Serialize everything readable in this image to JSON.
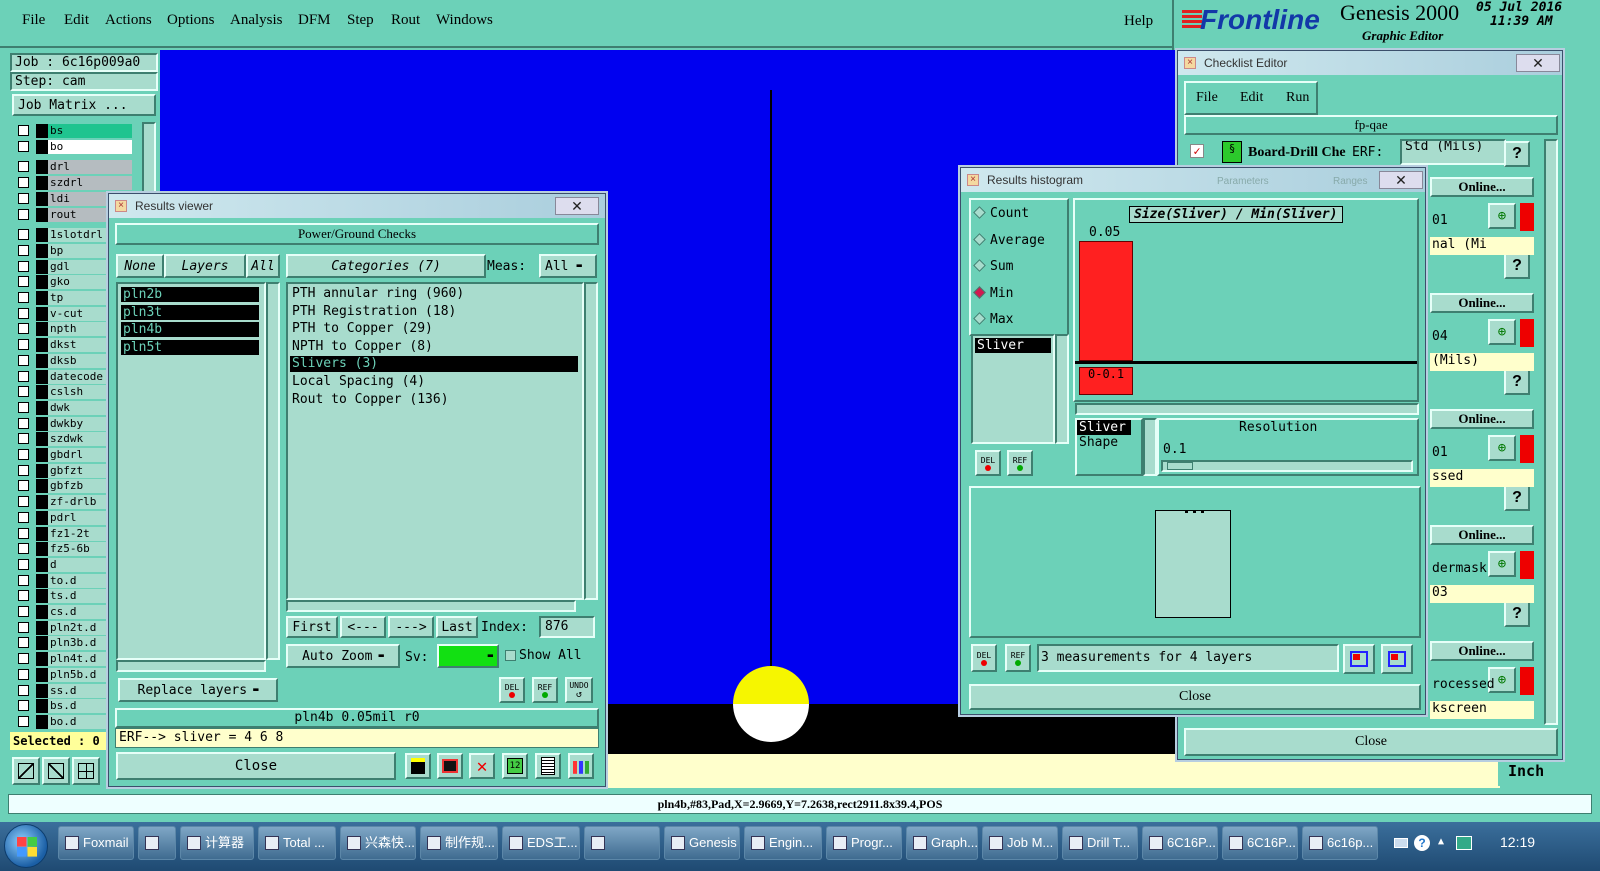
{
  "menu": [
    "File",
    "Edit",
    "Actions",
    "Options",
    "Analysis",
    "DFM",
    "Step",
    "Rout",
    "Windows"
  ],
  "help": "Help",
  "brand": {
    "logo": "Frontline",
    "product": "Genesis 2000",
    "subtitle": "Graphic Editor",
    "date": "05 Jul 2016",
    "time": "11:39 AM"
  },
  "job": {
    "job": "Job : 6c16p009a0",
    "step": "Step: cam",
    "matrix": "Job Matrix ...",
    "selected": "Selected : 0"
  },
  "layers": [
    "bs",
    "bo",
    "drl",
    "szdrl",
    "ldi",
    "rout",
    "1slotdrl",
    "bp",
    "gdl",
    "gko",
    "tp",
    "v-cut",
    "npth",
    "dkst",
    "dksb",
    "datecode",
    "cslsh",
    "dwk",
    "dwkby",
    "szdwk",
    "gbdrl",
    "gbfzt",
    "gbfzb",
    "zf-drlb",
    "pdrl",
    "fz1-2t",
    "fz5-6b",
    "d",
    "to.d",
    "ts.d",
    "cs.d",
    "pln2t.d",
    "pln3b.d",
    "pln4t.d",
    "pln5b.d",
    "ss.d",
    "bs.d",
    "bo.d"
  ],
  "results_viewer": {
    "title": "Results viewer",
    "header": "Power/Ground Checks",
    "none_btn": "None",
    "layers_btn": "Layers",
    "all_btn": "All",
    "categories_btn": "Categories (7)",
    "meas_label": "Meas:",
    "meas_value": "All",
    "layer_list": [
      "pln2b",
      "pln3t",
      "pln4b",
      "pln5t"
    ],
    "categories": [
      "PTH annular ring (960)",
      "PTH Registration (18)",
      "PTH to Copper (29)",
      "NPTH to Copper (8)",
      "Slivers (3)",
      "Local Spacing (4)",
      "Rout to Copper (136)"
    ],
    "selected_category": "Slivers (3)",
    "nav": {
      "first": "First",
      "prev": "<---",
      "next": "--->",
      "last": "Last",
      "index_label": "Index:",
      "index_value": "876"
    },
    "auto_zoom": "Auto Zoom",
    "sv_label": "Sv:",
    "show_all": "Show All",
    "replace_layers": "Replace layers",
    "status": "pln4b 0.05mil  r0",
    "erf": "ERF--> sliver = 4 6 8",
    "close": "Close",
    "icons": [
      "DEL",
      "REF",
      "UNDO"
    ]
  },
  "histogram": {
    "title": "Results histogram",
    "options": [
      "Count",
      "Average",
      "Sum",
      "Min",
      "Max"
    ],
    "selected_option": "Min",
    "chart_title": "Size(Sliver) / Min(Sliver)",
    "bar_value": "0.05",
    "bin_label": "0-0.1",
    "list": [
      "Sliver"
    ],
    "shape_list": [
      "Sliver",
      "Shape"
    ],
    "resolution_label": "Resolution",
    "resolution_value": "0.1",
    "measurements": "3 measurements for 4 layers",
    "close": "Close",
    "icons": [
      "DEL",
      "REF"
    ],
    "chart_data": {
      "type": "bar",
      "categories": [
        "0-0.1"
      ],
      "values": [
        0.05
      ],
      "title": "Size(Sliver) / Min(Sliver)"
    }
  },
  "checklist": {
    "title": "Checklist Editor",
    "menu": [
      "File",
      "Edit",
      "Run"
    ],
    "name": "fp-qae",
    "board_row": "Board-Drill Che",
    "erf": "ERF:",
    "std": "Std (Mils)",
    "online": "Online...",
    "partials": [
      "01",
      "nal (Mi",
      "04",
      "(Mils)",
      "01",
      "ssed",
      "dermask",
      "03",
      "rocessed",
      "kscreen",
      "01",
      "sed"
    ],
    "close": "Close",
    "bg_tabs": [
      "Parameters",
      "Ranges"
    ]
  },
  "units": "Inch",
  "coords": "pln4b,#83,Pad,X=2.9669,Y=7.2638,rect2911.8x39.4,POS",
  "taskbar": {
    "items": [
      "Foxmail",
      "",
      "计算器",
      "Total ...",
      "兴森快...",
      "制作规...",
      "EDS工...",
      "",
      "Genesis",
      "Engin...",
      "Progr...",
      "Graph...",
      "Job M...",
      "Drill T...",
      "6C16P...",
      "6C16P...",
      "6c16p..."
    ],
    "time": "12:19"
  },
  "colors": {
    "panel": "#6cd1b8",
    "canvas": "#0000f0",
    "hist_bar": "#ff2020",
    "taskbar": "#2a5678"
  }
}
